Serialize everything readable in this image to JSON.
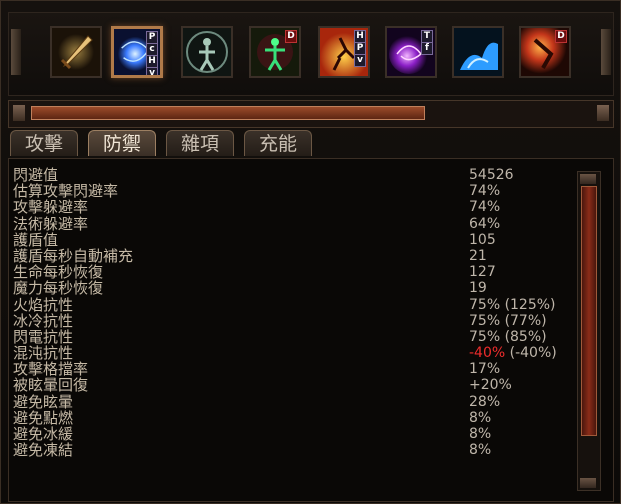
{
  "skills": [
    {
      "icon": "sword-icon",
      "tag": "",
      "selected": false
    },
    {
      "icon": "blue-orb-icon",
      "tag": "P c H v",
      "selected": true
    },
    {
      "icon": "body-aura-icon",
      "tag": "",
      "selected": false
    },
    {
      "icon": "green-figure-icon",
      "tag": "D",
      "selected": false
    },
    {
      "icon": "fire-dancer-icon",
      "tag": "H P v",
      "selected": false
    },
    {
      "icon": "purple-vortex-icon",
      "tag": "T f",
      "selected": false
    },
    {
      "icon": "blue-splash-icon",
      "tag": "",
      "selected": false
    },
    {
      "icon": "red-warrior-icon",
      "tag": "D",
      "selected": false
    }
  ],
  "scroll": {
    "position": 0.7
  },
  "tabs": [
    {
      "label": "攻擊",
      "active": false
    },
    {
      "label": "防禦",
      "active": true
    },
    {
      "label": "雜項",
      "active": false
    },
    {
      "label": "充能",
      "active": false
    }
  ],
  "stats": [
    {
      "label": "閃避值",
      "value": "54526"
    },
    {
      "label": "估算攻擊閃避率",
      "value": "74%"
    },
    {
      "label": "攻擊躲避率",
      "value": "74%"
    },
    {
      "label": "法術躲避率",
      "value": "64%"
    },
    {
      "label": "護盾值",
      "value": "105"
    },
    {
      "label": "護盾每秒自動補充",
      "value": "21"
    },
    {
      "label": "生命每秒恢復",
      "value": "127"
    },
    {
      "label": "魔力每秒恢復",
      "value": "19"
    },
    {
      "label": "火焰抗性",
      "value": "75% (125%)"
    },
    {
      "label": "冰冷抗性",
      "value": "75% (77%)"
    },
    {
      "label": "閃電抗性",
      "value": "75% (85%)"
    },
    {
      "label": "混沌抗性",
      "value_neg": "-40%",
      "value_rest": " (-40%)"
    },
    {
      "label": "攻擊格擋率",
      "value": "17%"
    },
    {
      "label": "被眩暈回復",
      "value": "+20%"
    },
    {
      "label": "避免眩暈",
      "value": "28%"
    },
    {
      "label": "避免點燃",
      "value": "8%"
    },
    {
      "label": "避免冰緩",
      "value": "8%"
    },
    {
      "label": "避免凍結",
      "value": "8%"
    }
  ],
  "colors": {
    "accent": "#b07a49",
    "negative": "#ee2c2c",
    "label": "#c5b9a5"
  }
}
